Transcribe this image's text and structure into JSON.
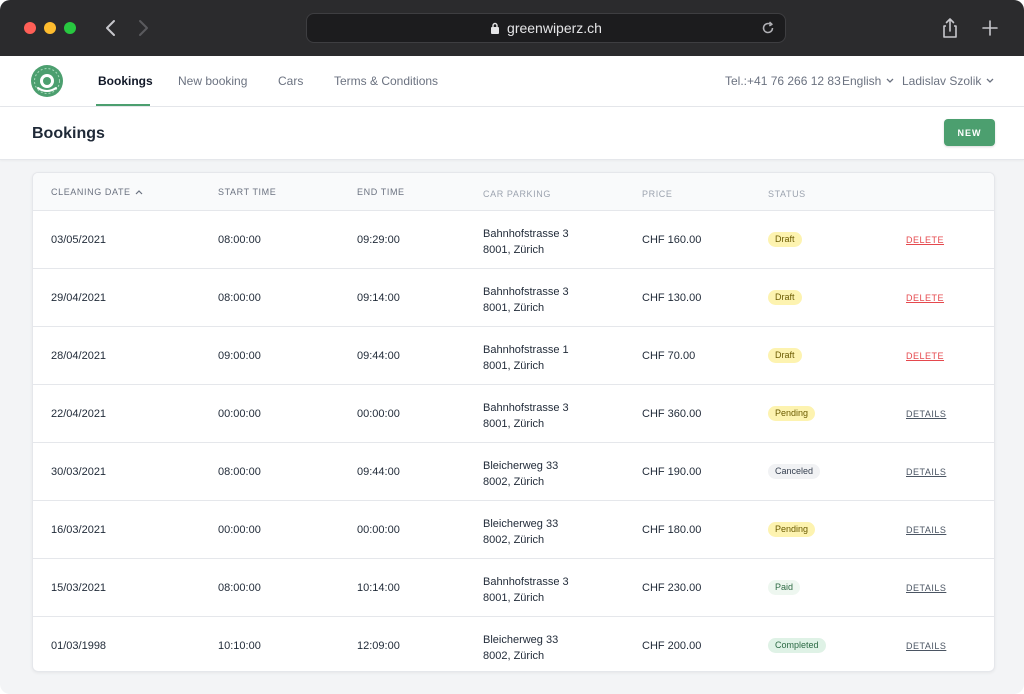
{
  "browser": {
    "url": "greenwiperz.ch"
  },
  "nav": {
    "links": [
      "Bookings",
      "New booking",
      "Cars",
      "Terms & Conditions"
    ],
    "phone": "Tel.:+41 76 266 12 83",
    "language": "English",
    "user": "Ladislav Szolik"
  },
  "page": {
    "title": "Bookings",
    "new_label": "NEW"
  },
  "table": {
    "columns": [
      "CLEANING DATE",
      "START TIME",
      "END TIME",
      "CAR PARKING",
      "PRICE",
      "STATUS"
    ],
    "rows": [
      {
        "date": "03/05/2021",
        "start": "08:00:00",
        "end": "09:29:00",
        "addr1": "Bahnhofstrasse 3",
        "addr2": "8001, Zürich",
        "price": "CHF 160.00",
        "status": "Draft",
        "action": "DELETE"
      },
      {
        "date": "29/04/2021",
        "start": "08:00:00",
        "end": "09:14:00",
        "addr1": "Bahnhofstrasse 3",
        "addr2": "8001, Zürich",
        "price": "CHF 130.00",
        "status": "Draft",
        "action": "DELETE"
      },
      {
        "date": "28/04/2021",
        "start": "09:00:00",
        "end": "09:44:00",
        "addr1": "Bahnhofstrasse 1",
        "addr2": "8001, Zürich",
        "price": "CHF 70.00",
        "status": "Draft",
        "action": "DELETE"
      },
      {
        "date": "22/04/2021",
        "start": "00:00:00",
        "end": "00:00:00",
        "addr1": "Bahnhofstrasse 3",
        "addr2": "8001, Zürich",
        "price": "CHF 360.00",
        "status": "Pending",
        "action": "DETAILS"
      },
      {
        "date": "30/03/2021",
        "start": "08:00:00",
        "end": "09:44:00",
        "addr1": "Bleicherweg 33",
        "addr2": "8002, Zürich",
        "price": "CHF 190.00",
        "status": "Canceled",
        "action": "DETAILS"
      },
      {
        "date": "16/03/2021",
        "start": "00:00:00",
        "end": "00:00:00",
        "addr1": "Bleicherweg 33",
        "addr2": "8002, Zürich",
        "price": "CHF 180.00",
        "status": "Pending",
        "action": "DETAILS"
      },
      {
        "date": "15/03/2021",
        "start": "08:00:00",
        "end": "10:14:00",
        "addr1": "Bahnhofstrasse 3",
        "addr2": "8001, Zürich",
        "price": "CHF 230.00",
        "status": "Paid",
        "action": "DETAILS"
      },
      {
        "date": "01/03/1998",
        "start": "10:10:00",
        "end": "12:09:00",
        "addr1": "Bleicherweg 33",
        "addr2": "8002, Zürich",
        "price": "CHF 200.00",
        "status": "Completed",
        "action": "DETAILS"
      }
    ]
  },
  "colors": {
    "brand": "#4c9f6f",
    "delete": "#e5484d"
  },
  "icons": [
    "back-icon",
    "forward-icon",
    "lock-icon",
    "reload-icon",
    "share-icon",
    "plus-icon",
    "logo-icon",
    "chevron-down-icon",
    "sort-asc-icon"
  ]
}
